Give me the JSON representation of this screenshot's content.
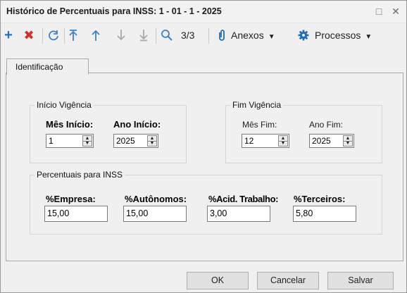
{
  "window": {
    "title": "Histórico de Percentuais para INSS: 1 - 01 - 1 - 2025"
  },
  "toolbar": {
    "record_counter": "3/3",
    "anexos_label": "Anexos",
    "processos_label": "Processos"
  },
  "tabs": [
    {
      "label": "Identificação"
    }
  ],
  "inicio_vigencia": {
    "legend": "Início Vigência",
    "mes_label": "Mês Início:",
    "mes_value": "1",
    "ano_label": "Ano Início:",
    "ano_value": "2025"
  },
  "fim_vigencia": {
    "legend": "Fim Vigência",
    "mes_label": "Mês Fim:",
    "mes_value": "12",
    "ano_label": "Ano Fim:",
    "ano_value": "2025"
  },
  "percentuais": {
    "legend": "Percentuais para INSS",
    "fields": [
      {
        "label": "%Empresa:",
        "value": "15,00"
      },
      {
        "label": "%Autônomos:",
        "value": "15,00"
      },
      {
        "label": "%Acid. Trabalho:",
        "value": "3,00"
      },
      {
        "label": "%Terceiros:",
        "value": "5,80"
      }
    ]
  },
  "buttons": {
    "ok": "OK",
    "cancel": "Cancelar",
    "save": "Salvar"
  },
  "colors": {
    "add_icon": "#1e73c8",
    "delete_icon": "#d0312d",
    "nav_icon": "#3b82c4",
    "paperclip_icon": "#1e6fbf",
    "gear_icon": "#1e6fbf"
  }
}
